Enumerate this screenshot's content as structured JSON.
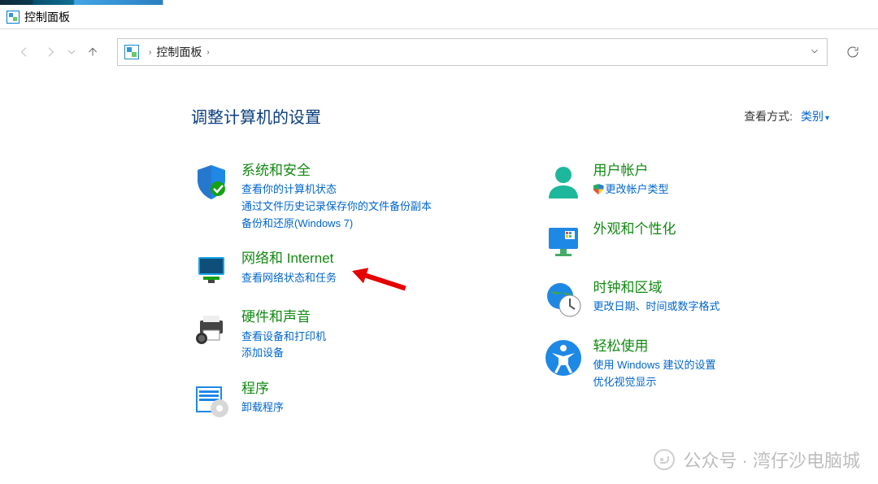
{
  "title_bar": {
    "title": "控制面板"
  },
  "addr": {
    "crumb0": "控制面板"
  },
  "header": {
    "title": "调整计算机的设置"
  },
  "viewby": {
    "label": "查看方式:",
    "value": "类别"
  },
  "left": {
    "security": {
      "title": "系统和安全",
      "s1": "查看你的计算机状态",
      "s2": "通过文件历史记录保存你的文件备份副本",
      "s3": "备份和还原(Windows 7)"
    },
    "network": {
      "title": "网络和 Internet",
      "s1": "查看网络状态和任务"
    },
    "hardware": {
      "title": "硬件和声音",
      "s1": "查看设备和打印机",
      "s2": "添加设备"
    },
    "programs": {
      "title": "程序",
      "s1": "卸载程序"
    }
  },
  "right": {
    "user": {
      "title": "用户帐户",
      "s1": "更改帐户类型"
    },
    "appearance": {
      "title": "外观和个性化"
    },
    "clock": {
      "title": "时钟和区域",
      "s1": "更改日期、时间或数字格式"
    },
    "ease": {
      "title": "轻松使用",
      "s1": "使用 Windows 建议的设置",
      "s2": "优化视觉显示"
    }
  },
  "watermark": {
    "text": "公众号 · 湾仔沙电脑城"
  }
}
